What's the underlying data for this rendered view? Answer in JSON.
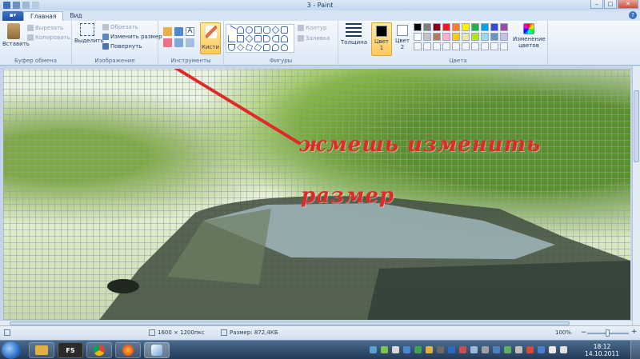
{
  "window": {
    "title": "3 - Paint",
    "minimize": "–",
    "maximize": "□",
    "close": "✕"
  },
  "tabs": {
    "app_menu": "▪▾",
    "items": [
      "Главная",
      "Вид"
    ],
    "help": "?"
  },
  "ribbon": {
    "clipboard": {
      "label": "Буфер обмена",
      "paste": "Вставить",
      "cut": "Вырезать",
      "copy": "Копировать"
    },
    "image": {
      "label": "Изображение",
      "select": "Выделить",
      "crop": "Обрезать",
      "resize": "Изменить размер",
      "rotate": "Повернуть"
    },
    "tools": {
      "label": "Инструменты"
    },
    "brushes": "Кисти",
    "shapes": {
      "label": "Фигуры",
      "outline": "Контур",
      "fill": "Заливка"
    },
    "size": "Толщина",
    "colors": {
      "label": "Цвета",
      "color1": "Цвет 1",
      "color2": "Цвет 2",
      "edit": "Изменение цветов",
      "color1_value": "#000000",
      "color2_value": "#ffffff",
      "palette": [
        "#000000",
        "#7f7f7f",
        "#880015",
        "#ed1c24",
        "#ff7f27",
        "#fff200",
        "#22b14c",
        "#00a2e8",
        "#3f48cc",
        "#a349a4",
        "#ffffff",
        "#c3c3c3",
        "#b97a57",
        "#ffaec9",
        "#ffc90e",
        "#efe4b0",
        "#b5e61d",
        "#99d9ea",
        "#7092be",
        "#c8bfe7"
      ]
    }
  },
  "annotation": {
    "line1": "жмешь изменить",
    "line2": "размер"
  },
  "status": {
    "dimensions": "1600 × 1200пкс",
    "file_size": "Размер: 872,4КБ",
    "zoom": "100%",
    "zoom_level": 0.5
  },
  "taskbar": {
    "app_label": "FS",
    "time": "18:12",
    "date": "14.10.2011"
  }
}
